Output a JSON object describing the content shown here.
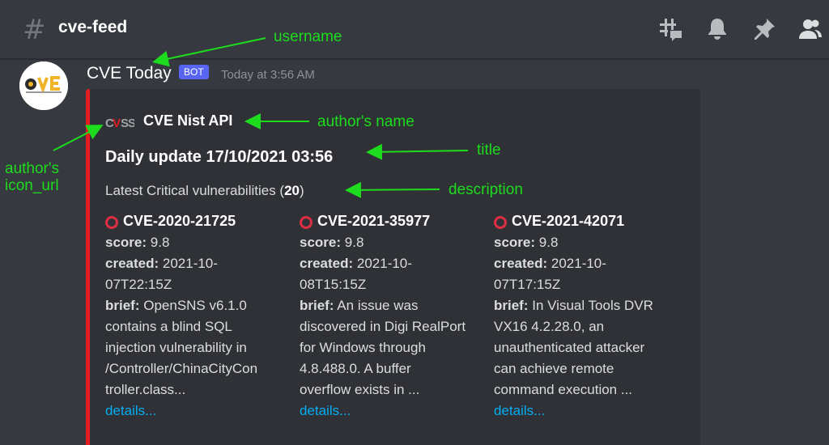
{
  "header": {
    "channel_name": "cve-feed",
    "hash_symbol": "#",
    "icons": [
      "threads-icon",
      "bell-icon",
      "pin-icon",
      "members-icon"
    ]
  },
  "message": {
    "username": "CVE Today",
    "badge": "BOT",
    "timestamp": "Today at 3:56 AM",
    "avatar_text": "CVE"
  },
  "embed": {
    "accent_color": "#e31b23",
    "author_icon_text": "CVSS",
    "author_name": "CVE Nist API",
    "title": "Daily update 17/10/2021 03:56",
    "description_prefix": "Latest Critical vulnerabilities (",
    "description_count": "20",
    "description_suffix": ")",
    "fields": [
      {
        "name": "CVE-2020-21725",
        "score_label": "score:",
        "score": "9.8",
        "created_label": "created:",
        "created_1": "2021-10-",
        "created_2": "07T22:15Z",
        "brief_label": "brief:",
        "brief_1": "OpenSNS v6.1.0",
        "brief_2": "contains a blind SQL",
        "brief_3": "injection vulnerability in",
        "brief_4": "/Controller/ChinaCityCon",
        "brief_5": "troller.class...",
        "link": "details..."
      },
      {
        "name": "CVE-2021-35977",
        "score_label": "score:",
        "score": "9.8",
        "created_label": "created:",
        "created_1": "2021-10-",
        "created_2": "08T15:15Z",
        "brief_label": "brief:",
        "brief_1": "An issue was",
        "brief_2": "discovered in Digi RealPort",
        "brief_3": "for Windows through",
        "brief_4": "4.8.488.0. A buffer",
        "brief_5": "overflow exists in ...",
        "link": "details..."
      },
      {
        "name": "CVE-2021-42071",
        "score_label": "score:",
        "score": "9.8",
        "created_label": "created:",
        "created_1": "2021-10-",
        "created_2": "07T17:15Z",
        "brief_label": "brief:",
        "brief_1": "In Visual Tools DVR",
        "brief_2": "VX16 4.2.28.0, an",
        "brief_3": "unauthenticated attacker",
        "brief_4": "can achieve remote",
        "brief_5": "command execution ...",
        "link": "details..."
      }
    ]
  },
  "annotations": {
    "color": "#1ddc1d",
    "username": "username",
    "author_name": "author's name",
    "title": "title",
    "description": "description",
    "icon_url_1": "author's",
    "icon_url_2": "icon_url"
  }
}
